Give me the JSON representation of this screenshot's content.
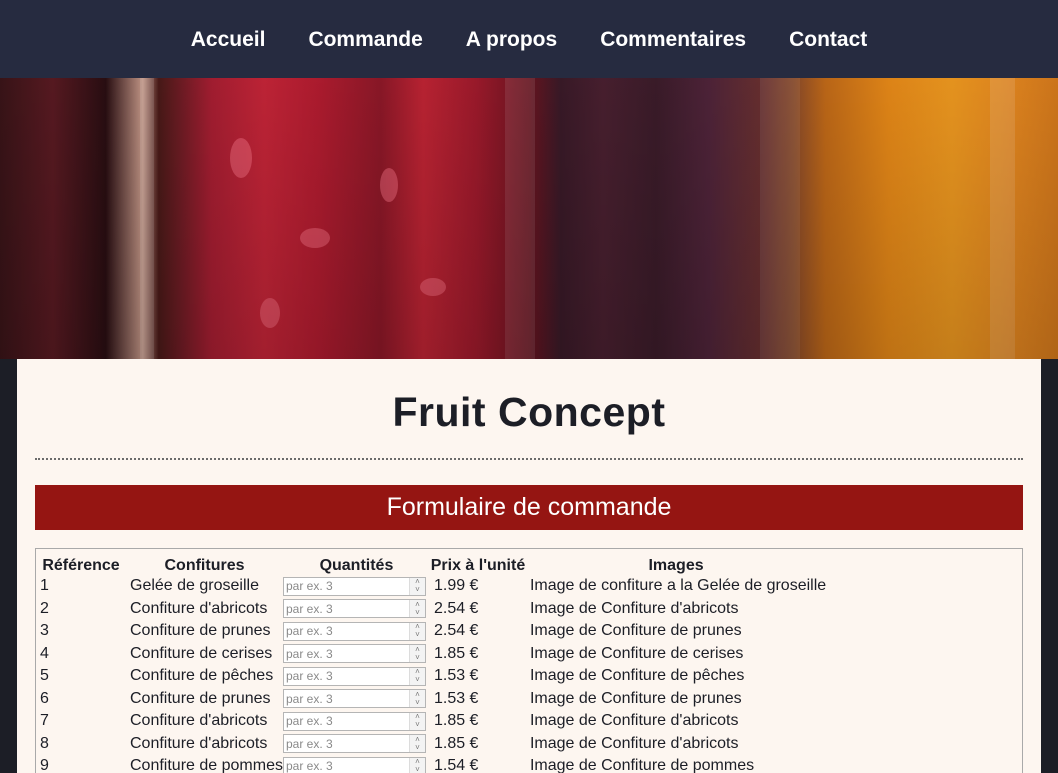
{
  "nav": {
    "items": [
      "Accueil",
      "Commande",
      "A propos",
      "Commentaires",
      "Contact"
    ]
  },
  "page": {
    "title": "Fruit Concept",
    "form_title": "Formulaire de commande"
  },
  "table": {
    "headers": {
      "reference": "Référence",
      "confitures": "Confitures",
      "quantites": "Quantités",
      "prix": "Prix à l'unité",
      "images": "Images"
    },
    "quantity_placeholder": "par ex. 3",
    "rows": [
      {
        "ref": "1",
        "name": "Gelée de groseille",
        "price": "1.99 €",
        "image": "Image de confiture a la Gelée de groseille"
      },
      {
        "ref": "2",
        "name": "Confiture d'abricots",
        "price": "2.54 €",
        "image": "Image de Confiture d'abricots"
      },
      {
        "ref": "3",
        "name": "Confiture de prunes",
        "price": "2.54 €",
        "image": "Image de Confiture de prunes"
      },
      {
        "ref": "4",
        "name": "Confiture de cerises",
        "price": "1.85 €",
        "image": "Image de Confiture de cerises"
      },
      {
        "ref": "5",
        "name": "Confiture de pêches",
        "price": "1.53 €",
        "image": "Image de Confiture de pêches"
      },
      {
        "ref": "6",
        "name": "Confiture de prunes",
        "price": "1.53 €",
        "image": "Image de Confiture de prunes"
      },
      {
        "ref": "7",
        "name": "Confiture d'abricots",
        "price": "1.85 €",
        "image": "Image de Confiture d'abricots"
      },
      {
        "ref": "8",
        "name": "Confiture d'abricots",
        "price": "1.85 €",
        "image": "Image de Confiture d'abricots"
      },
      {
        "ref": "9",
        "name": "Confiture de pommes",
        "price": "1.54 €",
        "image": "Image de Confiture de pommes"
      }
    ]
  },
  "colors": {
    "nav_bg": "#262b40",
    "banner_bg": "#951512",
    "content_bg": "#fdf6f0",
    "page_bg": "#1c1e26"
  }
}
